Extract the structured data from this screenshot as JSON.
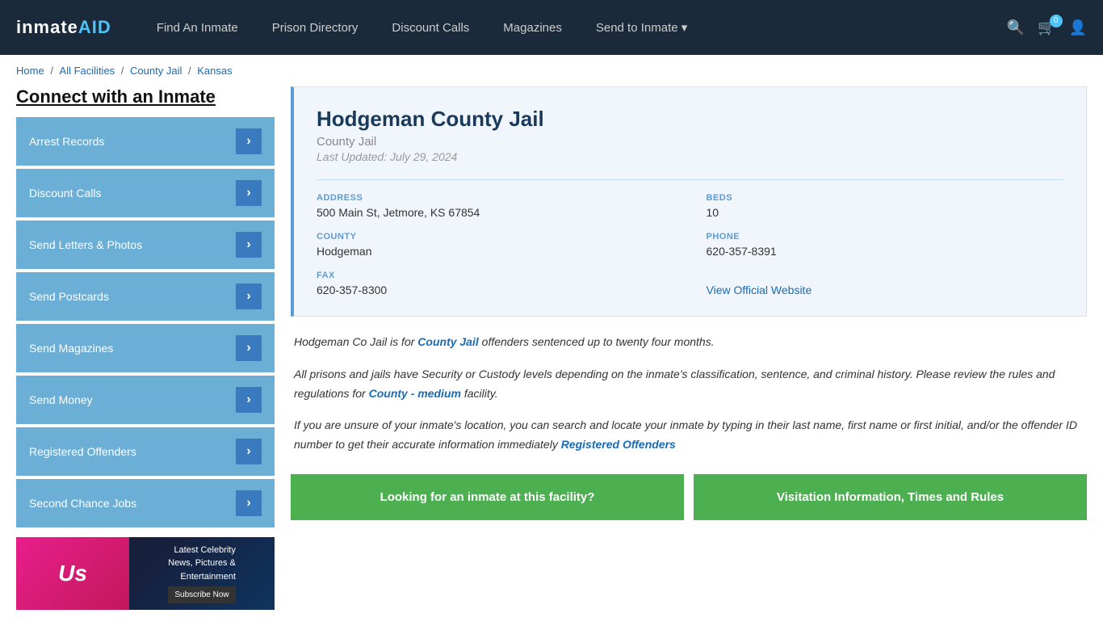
{
  "header": {
    "logo": "inmateAID",
    "nav": [
      {
        "label": "Find An Inmate",
        "id": "find-inmate"
      },
      {
        "label": "Prison Directory",
        "id": "prison-directory"
      },
      {
        "label": "Discount Calls",
        "id": "discount-calls"
      },
      {
        "label": "Magazines",
        "id": "magazines"
      },
      {
        "label": "Send to Inmate ▾",
        "id": "send-to-inmate"
      }
    ],
    "cart_count": "0",
    "search_label": "🔍",
    "cart_label": "🛒",
    "user_label": "👤"
  },
  "breadcrumb": {
    "items": [
      "Home",
      "All Facilities",
      "County Jail",
      "Kansas"
    ]
  },
  "sidebar": {
    "title": "Connect with an Inmate",
    "items": [
      {
        "label": "Arrest Records"
      },
      {
        "label": "Discount Calls"
      },
      {
        "label": "Send Letters & Photos"
      },
      {
        "label": "Send Postcards"
      },
      {
        "label": "Send Magazines"
      },
      {
        "label": "Send Money"
      },
      {
        "label": "Registered Offenders"
      },
      {
        "label": "Second Chance Jobs"
      }
    ],
    "ad": {
      "brand": "Us",
      "tagline": "Latest Celebrity\nNews, Pictures &\nEntertainment",
      "cta": "Subscribe Now"
    }
  },
  "facility": {
    "name": "Hodgeman County Jail",
    "type": "County Jail",
    "last_updated": "Last Updated: July 29, 2024",
    "address_label": "ADDRESS",
    "address": "500 Main St, Jetmore, KS 67854",
    "beds_label": "BEDS",
    "beds": "10",
    "county_label": "COUNTY",
    "county": "Hodgeman",
    "phone_label": "PHONE",
    "phone": "620-357-8391",
    "fax_label": "FAX",
    "fax": "620-357-8300",
    "website_label": "View Official Website",
    "website_url": "#"
  },
  "description": {
    "para1_pre": "Hodgeman Co Jail is for ",
    "para1_bold": "County Jail",
    "para1_post": " offenders sentenced up to twenty four months.",
    "para2_pre": "All prisons and jails have Security or Custody levels depending on the inmate's classification, sentence, and criminal history. Please review the rules and regulations for ",
    "para2_link": "County - medium",
    "para2_post": " facility.",
    "para3_pre": "If you are unsure of your inmate's location, you can search and locate your inmate by typing in their last name, first name or first initial, and/or the offender ID number to get their accurate information immediately ",
    "para3_link": "Registered Offenders"
  },
  "cta": {
    "btn1": "Looking for an inmate at this facility?",
    "btn2": "Visitation Information, Times and Rules"
  }
}
